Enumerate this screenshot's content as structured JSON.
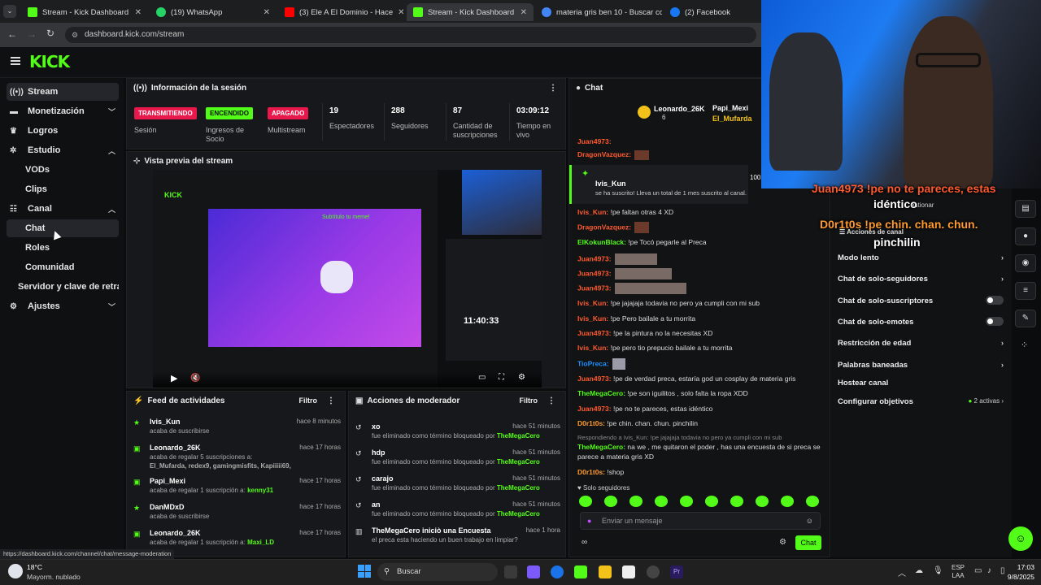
{
  "browser": {
    "tabs": [
      {
        "title": "Stream - Kick Dashboard",
        "color": "#53fc18"
      },
      {
        "title": "(19) WhatsApp",
        "color": "#25d366"
      },
      {
        "title": "(3) Ele A El Dominio - Hace",
        "color": "#ff0000"
      },
      {
        "title": "Stream - Kick Dashboard",
        "color": "#53fc18"
      },
      {
        "title": "materia gris ben 10 - Buscar co",
        "color": "#4285f4"
      },
      {
        "title": "(2) Facebook",
        "color": "#1877f2"
      }
    ],
    "url": "dashboard.kick.com/stream",
    "status_url": "https://dashboard.kick.com/channel/chat/message-moderation"
  },
  "brand": {
    "logo": "KICK",
    "accent": "#53fc18"
  },
  "sidebar": {
    "items": [
      {
        "label": "Stream",
        "icon": "broadcast-icon"
      },
      {
        "label": "Monetización",
        "icon": "money-icon"
      },
      {
        "label": "Logros",
        "icon": "trophy-icon"
      },
      {
        "label": "Estudio",
        "icon": "studio-icon"
      },
      {
        "label": "VODs"
      },
      {
        "label": "Clips"
      },
      {
        "label": "Canal",
        "icon": "channel-icon"
      },
      {
        "label": "Chat"
      },
      {
        "label": "Roles"
      },
      {
        "label": "Comunidad"
      },
      {
        "label": "Servidor y clave de retrans"
      },
      {
        "label": "Ajustes",
        "icon": "gear-icon"
      }
    ]
  },
  "session": {
    "title": "Información de la sesión",
    "stats": [
      {
        "badge": "TRANSMITIENDO",
        "label": "Sesión"
      },
      {
        "badge": "ENCENDIDO",
        "label": "Ingresos de Socio"
      },
      {
        "badge": "APAGADO",
        "label": "Multistream"
      },
      {
        "value": "19",
        "label": "Espectadores"
      },
      {
        "value": "288",
        "label": "Seguidores"
      },
      {
        "value": "87",
        "label": "Cantidad de suscripciones"
      },
      {
        "value": "03:09:12",
        "label": "Tiempo en vivo"
      }
    ]
  },
  "preview": {
    "title": "Vista previa del stream",
    "inner_text": "Subtítulo tu meme!",
    "inner_time": "11:40:33"
  },
  "feed": {
    "title": "Feed de actividades",
    "filter": "Filtro",
    "rows": [
      {
        "name": "Ivis_Kun",
        "desc": "acaba de suscribirse",
        "time": "hace 8 minutos"
      },
      {
        "name": "Leonardo_26K",
        "desc": "acaba de regalar 5 suscripciones a:",
        "extra": "El_Mufarda, redex9, gamingmisfits, Kapiiiii69,",
        "time": "hace 17 horas"
      },
      {
        "name": "Papi_Mexi",
        "desc": "acaba de regalar 1 suscripción a:",
        "extra": "kenny31",
        "time": "hace 17 horas"
      },
      {
        "name": "DanMDxD",
        "desc": "acaba de suscribirse",
        "time": "hace 17 horas"
      },
      {
        "name": "Leonardo_26K",
        "desc": "acaba de regalar 1 suscripción a:",
        "extra": "Maxi_LD",
        "time": "hace 17 horas"
      }
    ]
  },
  "modactions": {
    "title": "Acciones de moderador",
    "filter": "Filtro",
    "rows": [
      {
        "word": "xo",
        "desc": "fue eliminado como término bloqueado por",
        "by": "TheMegaCero",
        "time": "hace 51 minutos"
      },
      {
        "word": "hdp",
        "desc": "fue eliminado como término bloqueado por",
        "by": "TheMegaCero",
        "time": "hace 51 minutos"
      },
      {
        "word": "carajo",
        "desc": "fue eliminado como término bloqueado por",
        "by": "TheMegaCero",
        "time": "hace 51 minutos"
      },
      {
        "word": "an",
        "desc": "fue eliminado como término bloqueado por",
        "by": "TheMegaCero",
        "time": "hace 51 minutos"
      },
      {
        "word": "TheMegaCero iniciò una Encuesta",
        "desc": "el preca esta haciendo un buen trabajo en limpiar?",
        "by": "",
        "time": "hace 1 hora"
      }
    ]
  },
  "chat": {
    "title": "Chat",
    "top_gifters": [
      "Leonardo_26K",
      "6",
      "Papi_Mexi",
      "El_Mufarda"
    ],
    "sub_notice": {
      "user": "Ivis_Kun",
      "text": "se ha suscrito! Lleva un total de 1 mes suscrito al canal."
    },
    "messages": [
      {
        "user": "Juan4973:",
        "text": "",
        "color": "#ff5a2e"
      },
      {
        "user": "DragonVazquez:",
        "text": "",
        "color": "#ff5a2e"
      },
      {
        "user": "Ivis_Kun:",
        "text": "!pe faltan otras 4 XD",
        "color": "#ff5a2e"
      },
      {
        "user": "DragonVazquez:",
        "text": "",
        "color": "#ff5a2e"
      },
      {
        "user": "ElKokunBlack:",
        "text": "!pe Tocó pegarle al Preca",
        "color": "#53fc18"
      },
      {
        "user": "Juan4973:",
        "text": "",
        "color": "#ff5a2e"
      },
      {
        "user": "Juan4973:",
        "text": "",
        "color": "#ff5a2e"
      },
      {
        "user": "Juan4973:",
        "text": "",
        "color": "#ff5a2e"
      },
      {
        "user": "Ivis_Kun:",
        "text": "!pe jajajaja todavia no pero ya cumpli con mi sub",
        "color": "#ff5a2e"
      },
      {
        "user": "Ivis_Kun:",
        "text": "!pe Pero bailale a tu morrita",
        "color": "#ff5a2e"
      },
      {
        "user": "Juan4973:",
        "text": "!pe la pintura no la necesitas XD",
        "color": "#ff5a2e"
      },
      {
        "user": "Ivis_Kun:",
        "text": "!pe pero tio prepucio bailale a tu morrita",
        "color": "#ff5a2e"
      },
      {
        "user": "TioPreca:",
        "text": "",
        "color": "#1e90ff"
      },
      {
        "user": "Juan4973:",
        "text": "!pe de verdad preca, estaría god un cosplay de materia gris",
        "color": "#ff5a2e"
      },
      {
        "user": "TheMegaCero:",
        "text": "!pe son iguilitos , solo falta la ropa XDD",
        "color": "#53fc18"
      },
      {
        "user": "Juan4973:",
        "text": "!pe no te pareces, estas idéntico",
        "color": "#ff5a2e"
      },
      {
        "user": "D0r1t0s:",
        "text": "!pe chin. chan. chun. pinchilin",
        "color": "#ff9a2e"
      }
    ],
    "reply_ref": "Respondiendo a Ivis_Kun: !pe jajajaja todavia no pero ya cumpli con mi sub",
    "reply": {
      "user": "TheMegaCero:",
      "text": "na we , me quitaron el poder , has una encuesta de si preca se parece a materia gris XD"
    },
    "last": {
      "user": "D0r1t0s:",
      "text": "!shop"
    },
    "mode": "Solo seguidores",
    "input_placeholder": "Enviar un mensaje",
    "send": "Chat"
  },
  "overlay": {
    "line1": "Juan4973 !pe no te pareces, estas",
    "line1b": "idéntico",
    "line2": "D0r1t0s !pe chin. chan. chun.",
    "line2b": "pinchilin",
    "cam_small": "100",
    "gestionar": "estionar"
  },
  "chan_actions": {
    "title": "Acciones de canal",
    "items": [
      {
        "label": "Modo lento",
        "kind": "chevron"
      },
      {
        "label": "Chat de solo-seguidores",
        "kind": "chevron"
      },
      {
        "label": "Chat de solo-suscriptores",
        "kind": "toggle"
      },
      {
        "label": "Chat de solo-emotes",
        "kind": "toggle"
      },
      {
        "label": "Restricción de edad",
        "kind": "chevron"
      },
      {
        "label": "Palabras baneadas",
        "kind": "chevron"
      },
      {
        "label": "Hostear canal",
        "kind": "none"
      },
      {
        "label": "Configurar objetivos",
        "kind": "chevron",
        "extra": "2 activas"
      }
    ]
  },
  "taskbar": {
    "weather_temp": "18°C",
    "weather_desc": "Mayorm. nublado",
    "search": "Buscar",
    "lang1": "ESP",
    "lang2": "LAA",
    "time": "17:03",
    "date": "9/8/2025"
  }
}
